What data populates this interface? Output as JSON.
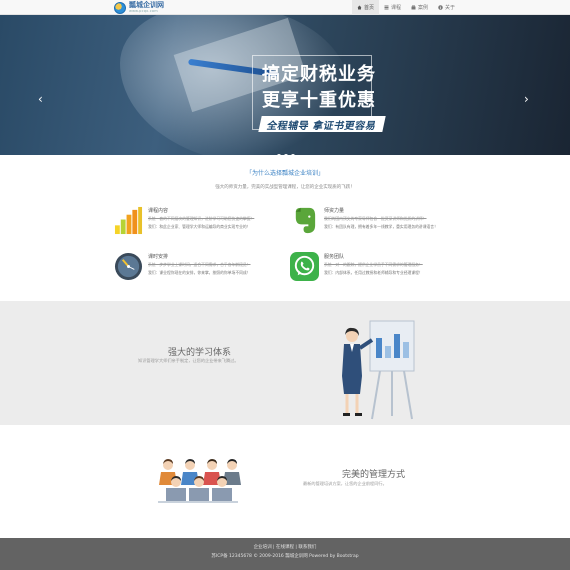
{
  "brand": {
    "name": "瓢城企训网",
    "sub": "www.pcqx.com"
  },
  "nav": [
    {
      "label": "首页",
      "icon": "home-icon",
      "active": true
    },
    {
      "label": "课程",
      "icon": "list-icon",
      "active": false
    },
    {
      "label": "案例",
      "icon": "case-icon",
      "active": false
    },
    {
      "label": "关于",
      "icon": "info-icon",
      "active": false
    }
  ],
  "carousel": {
    "title_line1": "搞定财税业务",
    "title_line2": "更享十重优惠",
    "subtitle": "全程辅导 拿证书更容易",
    "prev": "‹",
    "next": "›",
    "slides": 3,
    "active_slide": 1
  },
  "why": {
    "title": "「为什么选择瓢城企业培训」",
    "subtitle": "强大的师资力量，完美的实战型管理课程，让您的企业实现质的飞跃！",
    "features": [
      {
        "title": "课程内容",
        "line1": "系统一套的不同层次的管理知识，进阶学习可助您快速的掌握！",
        "line2": "我们：和此企业家、管理学大师和运编导的商业实现专业的！",
        "icon": "bar-chart-icon"
      },
      {
        "title": "师资力量",
        "line1": "我们的国内顶尖的专家导师包含一批资深讲师和优质的讲师！",
        "line2": "我们：有团队有理，拥有着多年一线教学，重实用理务的讲课语言！",
        "icon": "evernote-icon"
      },
      {
        "title": "课时安排",
        "line1": "系统一步步学业上课时间，适合不同需求，合乎各年龄段员！",
        "line2": "我们：课业程你现在的安排，你来掌，按照的你单场不同成！",
        "icon": "clock-icon"
      },
      {
        "title": "服务团队",
        "line1": "系统一对一的跟踪，提供企业学员手不同需求的管理服务！",
        "line2": "我们：内部体系，任用过教授和老师辅导和专业经理课程！",
        "icon": "whatsapp-icon"
      }
    ]
  },
  "learning": {
    "title": "强大的学习体系",
    "subtitle": "知识管理学大师们亲手制定，让您的企业带来飞腾过。"
  },
  "management": {
    "title": "完美的管理方式",
    "subtitle": "最新的管理培训方案，让您的企业前程同行。"
  },
  "footer": {
    "links": "企业培训 | 在线课程 | 联系我们",
    "copy": "苏ICP备 12345678 © 2009-2016 瓢城企训网 Powered by Bootstrap"
  },
  "colors": {
    "accent": "#3b82c4",
    "footer": "#636363",
    "section_bg": "#ececec"
  }
}
